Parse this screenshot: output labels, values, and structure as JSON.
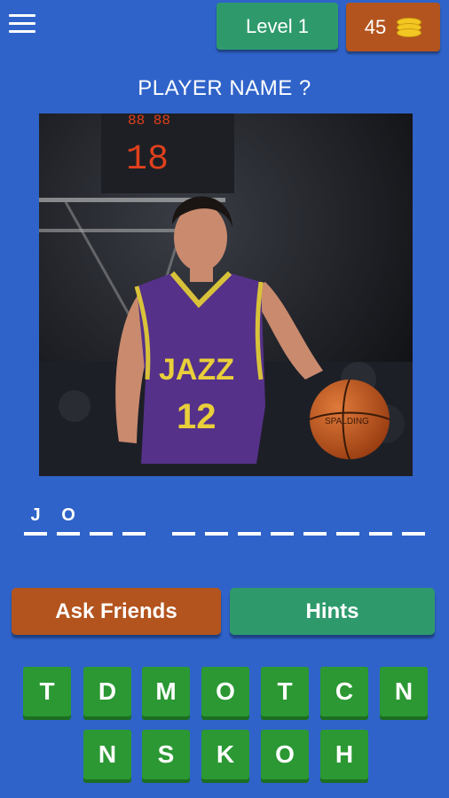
{
  "header": {
    "level_label": "Level 1",
    "coins": "45"
  },
  "question": "PLAYER NAME ?",
  "answer_slots": [
    "J",
    "O",
    "",
    "",
    "",
    "",
    "",
    "",
    "",
    "",
    "",
    "",
    ""
  ],
  "buttons": {
    "ask_friends": "Ask Friends",
    "hints": "Hints"
  },
  "keyboard": {
    "row1": [
      "T",
      "D",
      "M",
      "O",
      "T",
      "C",
      "N"
    ],
    "row2": [
      "N",
      "S",
      "K",
      "O",
      "H"
    ]
  },
  "colors": {
    "background": "#2f63c9",
    "green_button": "#2e9a6c",
    "orange_button": "#b3541e",
    "key_green": "#2b9833"
  },
  "icons": [
    "menu-icon",
    "coins-icon"
  ]
}
